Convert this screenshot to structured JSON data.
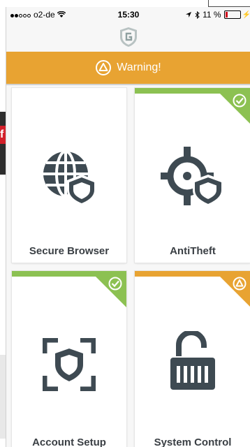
{
  "statusbar": {
    "carrier": "o2-de",
    "time": "15:30",
    "battery": "11 %"
  },
  "warning": {
    "label": "Warning!"
  },
  "tiles": [
    {
      "label": "Secure Browser",
      "status": "none"
    },
    {
      "label": "AntiTheft",
      "status": "ok"
    },
    {
      "label": "Account Setup",
      "status": "ok"
    },
    {
      "label": "System Control",
      "status": "warning"
    }
  ],
  "colors": {
    "warning": "#e8a332",
    "ok": "#8cc152",
    "icon": "#3e4a52"
  }
}
